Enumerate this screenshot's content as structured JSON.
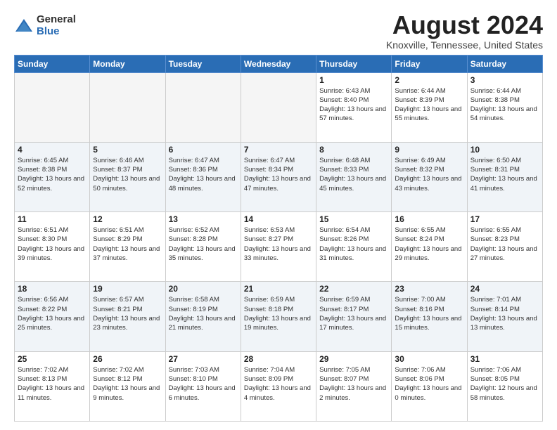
{
  "logo": {
    "general": "General",
    "blue": "Blue"
  },
  "title": "August 2024",
  "location": "Knoxville, Tennessee, United States",
  "weekdays": [
    "Sunday",
    "Monday",
    "Tuesday",
    "Wednesday",
    "Thursday",
    "Friday",
    "Saturday"
  ],
  "weeks": [
    [
      {
        "day": "",
        "info": ""
      },
      {
        "day": "",
        "info": ""
      },
      {
        "day": "",
        "info": ""
      },
      {
        "day": "",
        "info": ""
      },
      {
        "day": "1",
        "info": "Sunrise: 6:43 AM\nSunset: 8:40 PM\nDaylight: 13 hours and 57 minutes."
      },
      {
        "day": "2",
        "info": "Sunrise: 6:44 AM\nSunset: 8:39 PM\nDaylight: 13 hours and 55 minutes."
      },
      {
        "day": "3",
        "info": "Sunrise: 6:44 AM\nSunset: 8:38 PM\nDaylight: 13 hours and 54 minutes."
      }
    ],
    [
      {
        "day": "4",
        "info": "Sunrise: 6:45 AM\nSunset: 8:38 PM\nDaylight: 13 hours and 52 minutes."
      },
      {
        "day": "5",
        "info": "Sunrise: 6:46 AM\nSunset: 8:37 PM\nDaylight: 13 hours and 50 minutes."
      },
      {
        "day": "6",
        "info": "Sunrise: 6:47 AM\nSunset: 8:36 PM\nDaylight: 13 hours and 48 minutes."
      },
      {
        "day": "7",
        "info": "Sunrise: 6:47 AM\nSunset: 8:34 PM\nDaylight: 13 hours and 47 minutes."
      },
      {
        "day": "8",
        "info": "Sunrise: 6:48 AM\nSunset: 8:33 PM\nDaylight: 13 hours and 45 minutes."
      },
      {
        "day": "9",
        "info": "Sunrise: 6:49 AM\nSunset: 8:32 PM\nDaylight: 13 hours and 43 minutes."
      },
      {
        "day": "10",
        "info": "Sunrise: 6:50 AM\nSunset: 8:31 PM\nDaylight: 13 hours and 41 minutes."
      }
    ],
    [
      {
        "day": "11",
        "info": "Sunrise: 6:51 AM\nSunset: 8:30 PM\nDaylight: 13 hours and 39 minutes."
      },
      {
        "day": "12",
        "info": "Sunrise: 6:51 AM\nSunset: 8:29 PM\nDaylight: 13 hours and 37 minutes."
      },
      {
        "day": "13",
        "info": "Sunrise: 6:52 AM\nSunset: 8:28 PM\nDaylight: 13 hours and 35 minutes."
      },
      {
        "day": "14",
        "info": "Sunrise: 6:53 AM\nSunset: 8:27 PM\nDaylight: 13 hours and 33 minutes."
      },
      {
        "day": "15",
        "info": "Sunrise: 6:54 AM\nSunset: 8:26 PM\nDaylight: 13 hours and 31 minutes."
      },
      {
        "day": "16",
        "info": "Sunrise: 6:55 AM\nSunset: 8:24 PM\nDaylight: 13 hours and 29 minutes."
      },
      {
        "day": "17",
        "info": "Sunrise: 6:55 AM\nSunset: 8:23 PM\nDaylight: 13 hours and 27 minutes."
      }
    ],
    [
      {
        "day": "18",
        "info": "Sunrise: 6:56 AM\nSunset: 8:22 PM\nDaylight: 13 hours and 25 minutes."
      },
      {
        "day": "19",
        "info": "Sunrise: 6:57 AM\nSunset: 8:21 PM\nDaylight: 13 hours and 23 minutes."
      },
      {
        "day": "20",
        "info": "Sunrise: 6:58 AM\nSunset: 8:19 PM\nDaylight: 13 hours and 21 minutes."
      },
      {
        "day": "21",
        "info": "Sunrise: 6:59 AM\nSunset: 8:18 PM\nDaylight: 13 hours and 19 minutes."
      },
      {
        "day": "22",
        "info": "Sunrise: 6:59 AM\nSunset: 8:17 PM\nDaylight: 13 hours and 17 minutes."
      },
      {
        "day": "23",
        "info": "Sunrise: 7:00 AM\nSunset: 8:16 PM\nDaylight: 13 hours and 15 minutes."
      },
      {
        "day": "24",
        "info": "Sunrise: 7:01 AM\nSunset: 8:14 PM\nDaylight: 13 hours and 13 minutes."
      }
    ],
    [
      {
        "day": "25",
        "info": "Sunrise: 7:02 AM\nSunset: 8:13 PM\nDaylight: 13 hours and 11 minutes."
      },
      {
        "day": "26",
        "info": "Sunrise: 7:02 AM\nSunset: 8:12 PM\nDaylight: 13 hours and 9 minutes."
      },
      {
        "day": "27",
        "info": "Sunrise: 7:03 AM\nSunset: 8:10 PM\nDaylight: 13 hours and 6 minutes."
      },
      {
        "day": "28",
        "info": "Sunrise: 7:04 AM\nSunset: 8:09 PM\nDaylight: 13 hours and 4 minutes."
      },
      {
        "day": "29",
        "info": "Sunrise: 7:05 AM\nSunset: 8:07 PM\nDaylight: 13 hours and 2 minutes."
      },
      {
        "day": "30",
        "info": "Sunrise: 7:06 AM\nSunset: 8:06 PM\nDaylight: 13 hours and 0 minutes."
      },
      {
        "day": "31",
        "info": "Sunrise: 7:06 AM\nSunset: 8:05 PM\nDaylight: 12 hours and 58 minutes."
      }
    ]
  ]
}
